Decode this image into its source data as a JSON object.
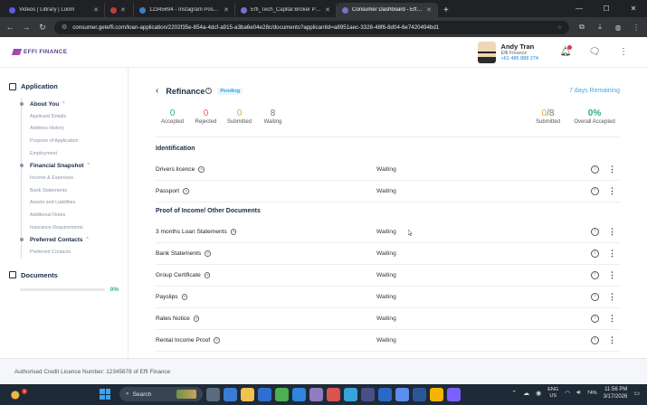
{
  "browser": {
    "tabs": [
      {
        "title": "Videos | Library | Loom",
        "color": "#5b5be6",
        "active": false
      },
      {
        "title": "",
        "color": "#c23b3b",
        "active": false
      },
      {
        "title": "12345694 - Instagram Post | ...",
        "color": "#3b82c4",
        "active": false
      },
      {
        "title": "Effi_Tech_Capital Broker Portal",
        "color": "#7b6cd6",
        "active": false
      },
      {
        "title": "Consumer Dashboard - Effi Fina...",
        "color": "#7b6cd6",
        "active": true
      }
    ],
    "url": "consumer.geteffi.com/loan-application/2202f35e-854a-4dcf-a915-a3ba6e04e28c/documents?applicantId=a8951aec-3328-48f6-8d04-6e7420494bd1"
  },
  "header": {
    "brand": "EFFI FINANCE",
    "user_name": "Andy Tran",
    "user_org": "Effi Finance",
    "user_phone": "+61 485 888 274"
  },
  "sidebar": {
    "application_label": "Application",
    "groups": [
      {
        "label": "About You",
        "subs": [
          "Applicant Details",
          "Address History",
          "Purpose of Application",
          "Employment"
        ]
      },
      {
        "label": "Financial Snapshot",
        "subs": [
          "Income & Expenses",
          "Bank Statements",
          "Assets and Liabilities",
          "Additional Notes",
          "Insurance Requirements"
        ]
      },
      {
        "label": "Preferred Contacts",
        "subs": [
          "Preferred Contacts"
        ]
      }
    ],
    "documents_label": "Documents",
    "documents_progress": "0%"
  },
  "main": {
    "title": "Refinance",
    "status_badge": "Pending",
    "days_remaining": "7 days Remaining",
    "stats": {
      "accepted": {
        "value": "0",
        "label": "Accepted"
      },
      "rejected": {
        "value": "0",
        "label": "Rejected"
      },
      "submitted": {
        "value": "0",
        "label": "Submitted"
      },
      "waiting": {
        "value": "8",
        "label": "Waiting"
      },
      "submitted_ratio": {
        "value": "0",
        "total": "/8",
        "label": "Submitted"
      },
      "overall": {
        "value": "0%",
        "label": "Overall Accepted"
      }
    },
    "sections": [
      {
        "title": "Identification",
        "docs": [
          {
            "name": "Drivers licence",
            "status": "Waiting"
          },
          {
            "name": "Passport",
            "status": "Waiting"
          }
        ]
      },
      {
        "title": "Proof of Income/ Other Documents",
        "docs": [
          {
            "name": "3 months Loan Statements",
            "status": "Waiting"
          },
          {
            "name": "Bank Statements",
            "status": "Waiting"
          },
          {
            "name": "Group Certificate",
            "status": "Waiting"
          },
          {
            "name": "Payslips",
            "status": "Waiting"
          },
          {
            "name": "Rates Notice",
            "status": "Waiting"
          },
          {
            "name": "Rental Income Proof",
            "status": "Waiting"
          }
        ]
      }
    ]
  },
  "footer": {
    "text": "Authorised Credit Licence Number: 12345678 of Effi Finance"
  },
  "taskbar": {
    "search_label": "Search",
    "weather_badge": "1",
    "lang": "ENG",
    "region": "US",
    "battery": "74%",
    "time": "11:56 PM",
    "date": "3/17/2026"
  }
}
